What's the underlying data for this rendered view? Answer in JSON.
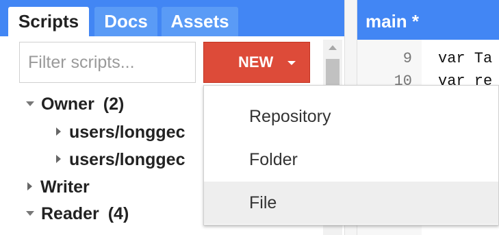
{
  "tabs": [
    {
      "label": "Scripts"
    },
    {
      "label": "Docs"
    },
    {
      "label": "Assets"
    }
  ],
  "filter": {
    "placeholder": "Filter scripts..."
  },
  "new_button": {
    "label": "NEW"
  },
  "tree": {
    "owner": {
      "label": "Owner",
      "count": "(2)"
    },
    "owner_children": [
      {
        "label": "users/longgec"
      },
      {
        "label": "users/longgec"
      }
    ],
    "writer": {
      "label": "Writer"
    },
    "reader": {
      "label": "Reader",
      "count": "(4)"
    }
  },
  "editor": {
    "title": "main *",
    "lines": [
      {
        "num": "9",
        "code": "var Ta"
      },
      {
        "num": "10",
        "code": "var re"
      }
    ]
  },
  "menu": {
    "items": [
      {
        "label": "Repository"
      },
      {
        "label": "Folder"
      },
      {
        "label": "File"
      }
    ]
  },
  "colors": {
    "header_blue": "#4286f4",
    "new_button_red": "#dd4b39",
    "menu_highlight": "#eeeeee"
  }
}
